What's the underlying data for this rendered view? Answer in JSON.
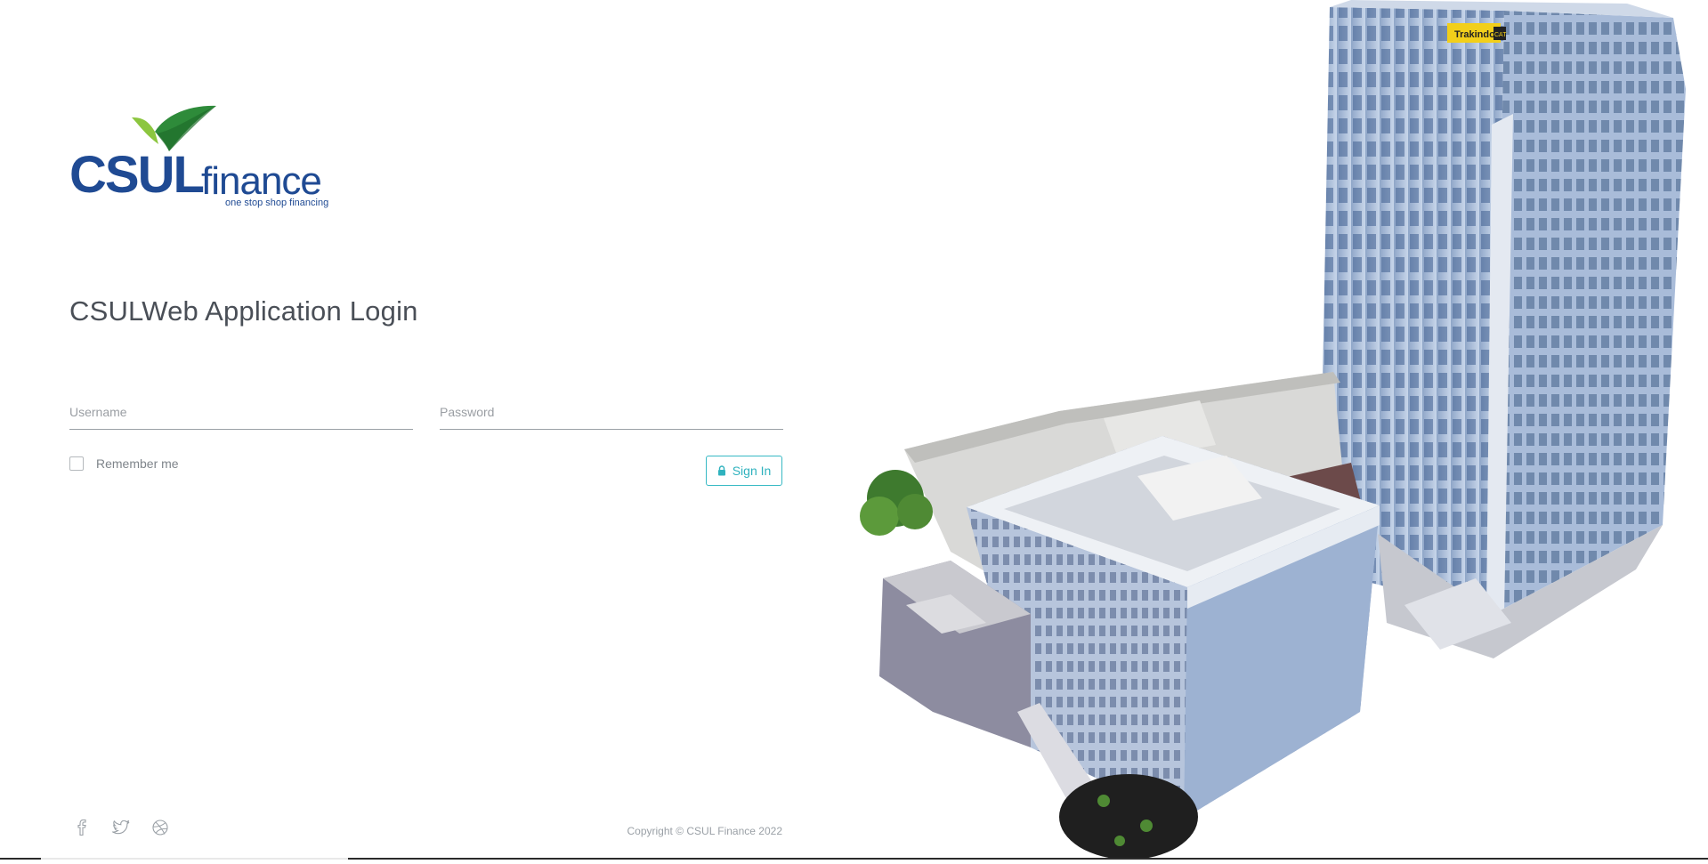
{
  "brand": {
    "logo_primary": "CSUL",
    "logo_secondary": "finance",
    "tagline": "one stop shop financing",
    "primary_color": "#1f4a93",
    "leaf_color": "#2e8b3a",
    "accent_color": "#2fb2be"
  },
  "login": {
    "title": "CSULWeb Application Login",
    "username_placeholder": "Username",
    "password_placeholder": "Password",
    "remember_label": "Remember me",
    "remember_checked": false,
    "signin_label": "Sign In",
    "signin_icon": "lock-icon"
  },
  "social": {
    "icons": [
      "facebook-icon",
      "twitter-icon",
      "dribbble-icon"
    ]
  },
  "footer": {
    "copyright": "Copyright © CSUL Finance 2022"
  },
  "building_sign": {
    "text": "Trakindo",
    "badge": "CAT"
  }
}
